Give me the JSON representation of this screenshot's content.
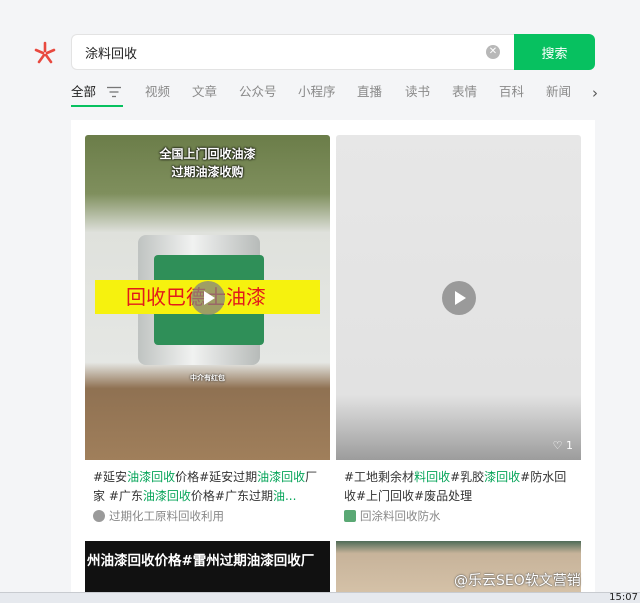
{
  "search": {
    "query": "涂料回收",
    "button_label": "搜索"
  },
  "tabs": [
    {
      "label": "全部"
    },
    {
      "label": "视频"
    },
    {
      "label": "文章"
    },
    {
      "label": "公众号"
    },
    {
      "label": "小程序"
    },
    {
      "label": "直播"
    },
    {
      "label": "读书"
    },
    {
      "label": "表情"
    },
    {
      "label": "百科"
    },
    {
      "label": "新闻"
    }
  ],
  "results": [
    {
      "caption_line1": "全国上门回收油漆",
      "caption_line2": "过期油漆收购",
      "banner": "回收巴德士油漆",
      "video_caption": "中介有红包",
      "desc_parts": [
        "#延安",
        "油漆回收",
        "价格#延安过期",
        "油漆回收",
        "厂家 #广东",
        "油漆回收",
        "价格#广东过期",
        "油..."
      ],
      "source": "过期化工原料回收利用"
    },
    {
      "likes": "1",
      "desc_parts": [
        "#工地剩余材",
        "料回收",
        "#乳胶",
        "漆回收",
        "#防水回收#上门回收#废品处理"
      ],
      "source": "回涂料回收防水"
    },
    {
      "caption": "州油漆回收价格#雷州过期油漆回收厂"
    }
  ],
  "watermark": "@乐云SEO软文营销",
  "clock": "15:07",
  "colors": {
    "accent": "#07c160",
    "highlight": "#07a55a",
    "background": "#f4f5f7"
  }
}
